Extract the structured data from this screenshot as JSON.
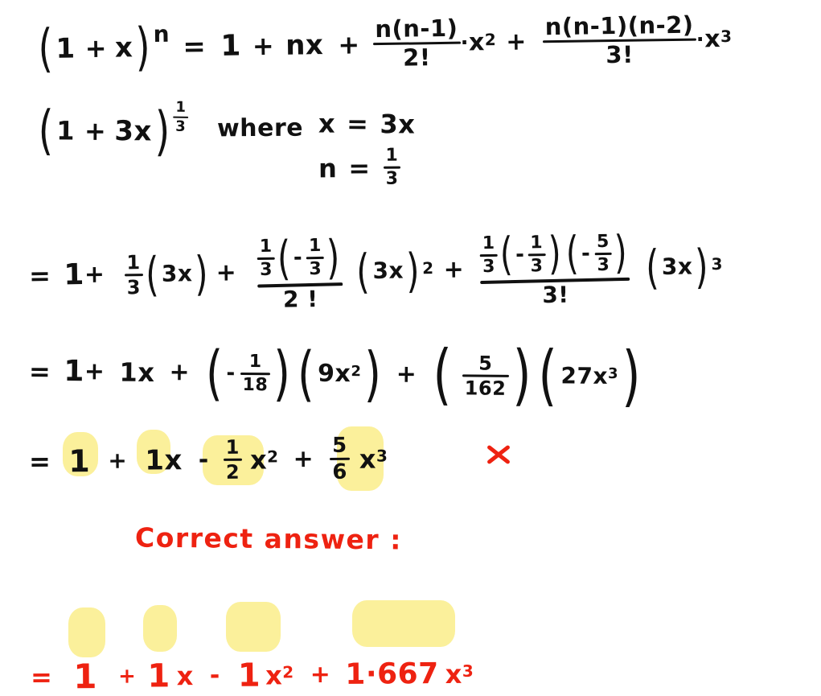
{
  "document": {
    "title": "Handwritten binomial expansion worksheet",
    "background_color": "#ffffff",
    "ink_color": "#111111",
    "correction_color": "#EE2211",
    "highlight_color": "#FBF09B"
  },
  "line1": {
    "lhs_open": "(",
    "lhs_one": "1",
    "lhs_plus": "+",
    "lhs_x": "x",
    "lhs_close": ")",
    "lhs_exp": "n",
    "equals": "=",
    "term0": "1",
    "plus1": "+",
    "term1": "nx",
    "plus2": "+",
    "frac2_num": "n(n-1)",
    "frac2_den": "2!",
    "frac2_dot": "·",
    "frac2_var": "x",
    "frac2_pow": "2",
    "plus3": "+",
    "frac3_num": "n(n-1)(n-2)",
    "frac3_den": "3!",
    "frac3_dot": "·",
    "frac3_var": "x",
    "frac3_pow": "3"
  },
  "line2": {
    "open": "(",
    "one": "1",
    "plus": "+",
    "threex": "3x",
    "close": ")",
    "exp_num": "1",
    "exp_den": "3",
    "where": "where",
    "sub_x_var": "x",
    "sub_x_eq": "=",
    "sub_x_val": "3x",
    "sub_n_var": "n",
    "sub_n_eq": "=",
    "sub_n_num": "1",
    "sub_n_den": "3"
  },
  "line3": {
    "equals": "=",
    "one": "1",
    "plus1": "+",
    "c1_num": "1",
    "c1_den": "3",
    "g1_open": "(",
    "g1_body": "3x",
    "g1_close": ")",
    "plus2": "+",
    "c2_a_num": "1",
    "c2_a_den": "3",
    "c2_open": "(",
    "c2_minus": "-",
    "c2_b_num": "1",
    "c2_b_den": "3",
    "c2_close": ")",
    "c2_den": "2 !",
    "g2_open": "(",
    "g2_body": "3x",
    "g2_close": ")",
    "g2_pow": "2",
    "plus3": "+",
    "c3_a_num": "1",
    "c3_a_den": "3",
    "c3_open1": "(",
    "c3_minus1": "-",
    "c3_b_num": "1",
    "c3_b_den": "3",
    "c3_close1": ")",
    "c3_open2": "(",
    "c3_minus2": "-",
    "c3_c_num": "5",
    "c3_c_den": "3",
    "c3_close2": ")",
    "c3_den": "3!",
    "g3_open": "(",
    "g3_body": "3x",
    "g3_close": ")",
    "g3_pow": "3"
  },
  "line4": {
    "equals": "=",
    "one": "1",
    "plus1": "+",
    "term1": "1x",
    "plus2": "+",
    "p1_open": "(",
    "p1_minus": "-",
    "p1_num": "1",
    "p1_den": "18",
    "p1_close": ")",
    "p2_open": "(",
    "p2_body": "9x",
    "p2_pow": "2",
    "p2_close": ")",
    "plus3": "+",
    "p3_open": "(",
    "p3_num": "5",
    "p3_den": "162",
    "p3_close": ")",
    "p4_open": "(",
    "p4_body": "27x",
    "p4_pow": "3",
    "p4_close": ")"
  },
  "line5": {
    "equals": "=",
    "one": "1",
    "plus1": "+",
    "term1": "1x",
    "minus": "-",
    "c2_num": "1",
    "c2_den": "2",
    "var2": "x",
    "pow2": "2",
    "plus2": "+",
    "c3_num": "5",
    "c3_den": "6",
    "var3": "x",
    "pow3": "3",
    "mark": "x-mark-wrong"
  },
  "correct_label": {
    "text": "Correct answer :"
  },
  "line6": {
    "equals": "=",
    "one": "1",
    "plus1": "+",
    "term1": "1",
    "var1": "x",
    "minus": "-",
    "coef2": "1",
    "var2": "x",
    "pow2": "2",
    "plus2": "+",
    "coef3": "1·667",
    "var3": "x",
    "pow3": "3"
  }
}
